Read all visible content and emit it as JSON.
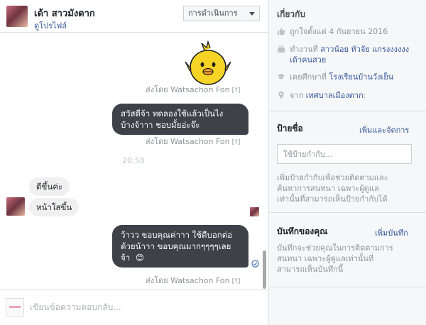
{
  "header": {
    "name": "เด้า สาวมังตาก",
    "profile_link": "ดูโปรไฟล์",
    "actions_label": "การดำเนินการ"
  },
  "messages": {
    "sent_by_1": "ส่งโดย Watsachon Fon",
    "sent_by_2": "ส่งโดย Watsachon Fon",
    "sent_by_3": "ส่งโดย Watsachon Fon",
    "q_mark": "[?]",
    "outgoing_1_line1": "สวัสดีจ้า ทดลองใช้แล้วเป็นไง",
    "outgoing_1_line2": "บ้างจ้าาา ชอบมั้ยอ่ะจ๊ะ",
    "timestamp": "20:50",
    "incoming_1": "ดีขึ้นค่ะ",
    "incoming_2": "หน้าใสขึ้น",
    "outgoing_2_line1": "ว้าวว ขอบคุณค่าาา ใช้ดีบอกต่อ",
    "outgoing_2_line2": "ด้วยน้าาา ขอบคุณมากๆๆๆๆเลย",
    "outgoing_2_line3": "จ้า",
    "emoji": "😊"
  },
  "composer": {
    "placeholder": "เขียนข้อความตอบกลับ..."
  },
  "sidebar": {
    "about_title": "เกี่ยวกับ",
    "liked_since": "ถูกใจตั้งแต่ 4 กันยายน 2016",
    "work_prefix": "ทำงานที่ ",
    "work_link": "สาวน้อย หัวจัย แกรงงงงงง เด้าคนสวย",
    "study_prefix": "เคยศึกษาที่ ",
    "study_link": "โรงเรียนบ้านวังเย็น",
    "from_prefix": "จาก ",
    "from_link": "เทศบาลเมืองตาก",
    "from_suffix": ":",
    "tags_title": "ป้ายชื่อ",
    "tags_link": "เพิ่มและจัดการ",
    "tag_placeholder": "ใช้ป้ายกำกับ...",
    "tags_help_line1": "เพิ่มป้ายกำกับเพื่อช่วยติดตามและ",
    "tags_help_line2": "ค้นหาการสนทนา เฉพาะผู้ดูแล",
    "tags_help_line3": "เท่านั้นที่สามารถเห็นป้ายกำกับได้",
    "notes_title": "บันทึกของคุณ",
    "notes_link": "เพิ่มบันทึก",
    "notes_help_line1": "บันทึกจะช่วยคุณในการติดตามการ",
    "notes_help_line2": "สนทนา เฉพาะผู้ดูแลเท่านั้นที่",
    "notes_help_line3": "สามารถเห็นบันทึกนี้"
  },
  "icons": {
    "attach": "paperclip-icon",
    "emoji": "smiley-icon",
    "sticker": "chat-bubble-icon",
    "like": "thumbs-up-icon"
  },
  "colors": {
    "link": "#365899",
    "bubble_out": "#3e4147",
    "like_blue": "#4267b2"
  }
}
